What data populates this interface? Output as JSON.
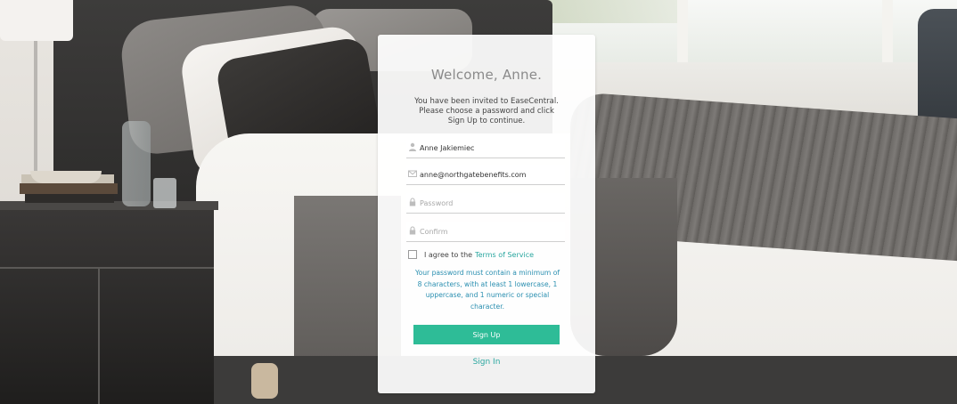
{
  "card": {
    "title": "Welcome, Anne.",
    "intro_lines": [
      "You have been invited to EaseCentral.",
      "Please choose a password and click",
      "Sign Up to continue."
    ]
  },
  "form": {
    "name": {
      "value": "Anne Jakiemiec",
      "icon": "user-icon"
    },
    "email": {
      "value": "anne@northgatebenefits.com",
      "icon": "envelope-icon"
    },
    "password": {
      "placeholder": "Password",
      "icon": "lock-icon"
    },
    "confirm": {
      "placeholder": "Confirm",
      "icon": "lock-icon"
    },
    "agree_text": "I agree to the",
    "terms_link": "Terms of Service",
    "password_rules_lines": [
      "Your password must contain a minimum of",
      "8 characters, with at least 1 lowercase, 1",
      "uppercase, and 1 numeric or special",
      "character."
    ],
    "signup_label": "Sign Up",
    "signin_label": "Sign In"
  },
  "colors": {
    "accent": "#2ebc97",
    "link": "#2aa7a0",
    "rules_text": "#2a8fb0"
  }
}
